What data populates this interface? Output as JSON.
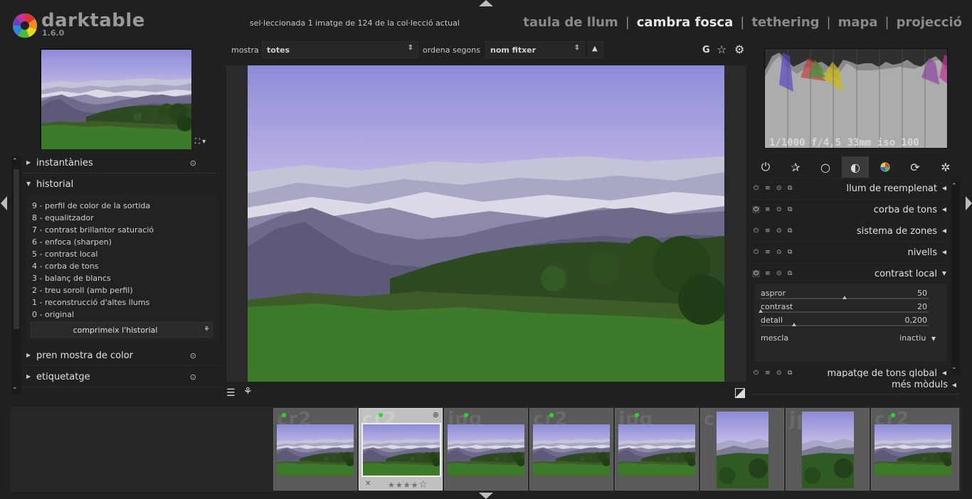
{
  "header": {
    "app_name": "darktable",
    "version": "1.6.0",
    "status": "sel·leccionada 1 imatge de 124 de la col·lecció actual",
    "views": [
      {
        "label": "taula de llum",
        "active": false
      },
      {
        "label": "cambra fosca",
        "active": true
      },
      {
        "label": "tethering",
        "active": false
      },
      {
        "label": "mapa",
        "active": false
      },
      {
        "label": "projecció",
        "active": false
      }
    ],
    "separator": "|"
  },
  "toolbar": {
    "filter_label": "mostra",
    "filter_value": "totes",
    "sort_label": "ordena segons",
    "sort_value": "nom fitxer",
    "grouping_label": "G"
  },
  "left_panel": {
    "sections": [
      {
        "label": "instantànies",
        "expanded": false
      },
      {
        "label": "historial",
        "expanded": true
      },
      {
        "label": "pren mostra de color",
        "expanded": false
      },
      {
        "label": "etiquetatge",
        "expanded": false
      }
    ],
    "history": [
      "9 - perfil de color de la sortida",
      "8 - equalitzador",
      "7 - contrast brillantor saturació",
      "6 - enfoca (sharpen)",
      "5 - contrast local",
      "4 - corba de tons",
      "3 - balanç de blancs",
      "2 - treu soroll (amb perfil)",
      "1 - reconstrucció d'altes llums",
      "0 - original"
    ],
    "compress_button": "comprimeix l'historial"
  },
  "right_panel": {
    "exif": "1/1000 f/4,5 33mm iso 100",
    "module_groups": [
      "power-icon",
      "star-icon",
      "circle-icon",
      "half-circle-icon",
      "color-wheel-icon",
      "rotate-icon",
      "aperture-icon"
    ],
    "modules": [
      {
        "label": "llum de reemplenat",
        "enabled": false,
        "expanded": false
      },
      {
        "label": "corba de tons",
        "enabled": true,
        "expanded": false
      },
      {
        "label": "sistema de zones",
        "enabled": false,
        "expanded": false
      },
      {
        "label": "nivells",
        "enabled": false,
        "expanded": false
      },
      {
        "label": "contrast local",
        "enabled": true,
        "expanded": true
      },
      {
        "label": "mapatge de tons global",
        "enabled": false,
        "expanded": false
      }
    ],
    "local_contrast": {
      "sliders": [
        {
          "label": "aspror",
          "value": "50",
          "fraction": 0.5
        },
        {
          "label": "contrast",
          "value": "20",
          "fraction": 0.0
        },
        {
          "label": "detall",
          "value": "0,200",
          "fraction": 0.2
        }
      ],
      "blend_label": "mescla",
      "blend_value": "inactiu"
    },
    "more_modules": "més mòduls"
  },
  "filmstrip": {
    "thumbs": [
      {
        "ext": "cr2",
        "selected": false
      },
      {
        "ext": "cr2",
        "selected": true
      },
      {
        "ext": "jpg",
        "selected": false
      },
      {
        "ext": "cr2",
        "selected": false
      },
      {
        "ext": "jpg",
        "selected": false
      },
      {
        "ext": "cr2",
        "selected": false
      },
      {
        "ext": "jpg",
        "selected": false
      },
      {
        "ext": "cr2",
        "selected": false
      }
    ]
  },
  "colors": {
    "background": "#202020",
    "panel": "#262626",
    "text": "#c8c8c8",
    "active_view": "#e6e6e6",
    "inactive_view": "#8a8a8a",
    "color_label_green": "#22dd22"
  }
}
